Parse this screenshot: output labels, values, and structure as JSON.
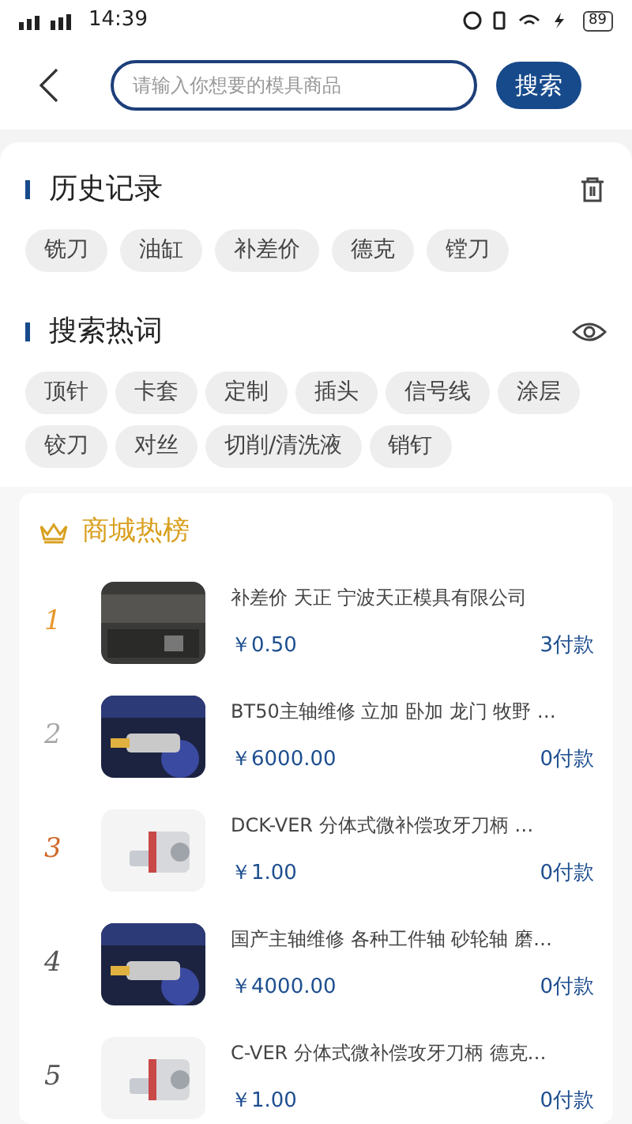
{
  "status_bar": {
    "time": "14:39",
    "battery": "89"
  },
  "search": {
    "placeholder": "请输入你想要的模具商品",
    "button": "搜索"
  },
  "history": {
    "title": "历史记录",
    "tags": [
      "铣刀",
      "油缸",
      "补差价",
      "德克",
      "镗刀"
    ]
  },
  "hot_words": {
    "title": "搜索热词",
    "tags": [
      "顶针",
      "卡套",
      "定制",
      "插头",
      "信号线",
      "涂层",
      "铰刀",
      "对丝",
      "切削/清洗液",
      "销钉"
    ]
  },
  "hot_list": {
    "title": "商城热榜",
    "products": [
      {
        "rank": "1",
        "color": "#e8962e",
        "title": "补差价 天正 宁波天正模具有限公司",
        "price": "￥0.50",
        "payments": "3付款"
      },
      {
        "rank": "2",
        "color": "#a8a8a8",
        "title": "BT50主轴维修 立加 卧加 龙门 牧野 …",
        "price": "￥6000.00",
        "payments": "0付款"
      },
      {
        "rank": "3",
        "color": "#d2692a",
        "title": "DCK-VER 分体式微补偿攻牙刀柄 …",
        "price": "￥1.00",
        "payments": "0付款"
      },
      {
        "rank": "4",
        "color": "#555555",
        "title": "国产主轴维修 各种工件轴 砂轮轴 磨…",
        "price": "￥4000.00",
        "payments": "0付款"
      },
      {
        "rank": "5",
        "color": "#555555",
        "title": "C-VER 分体式微补偿攻牙刀柄 德克…",
        "price": "￥1.00",
        "payments": "0付款"
      }
    ]
  }
}
